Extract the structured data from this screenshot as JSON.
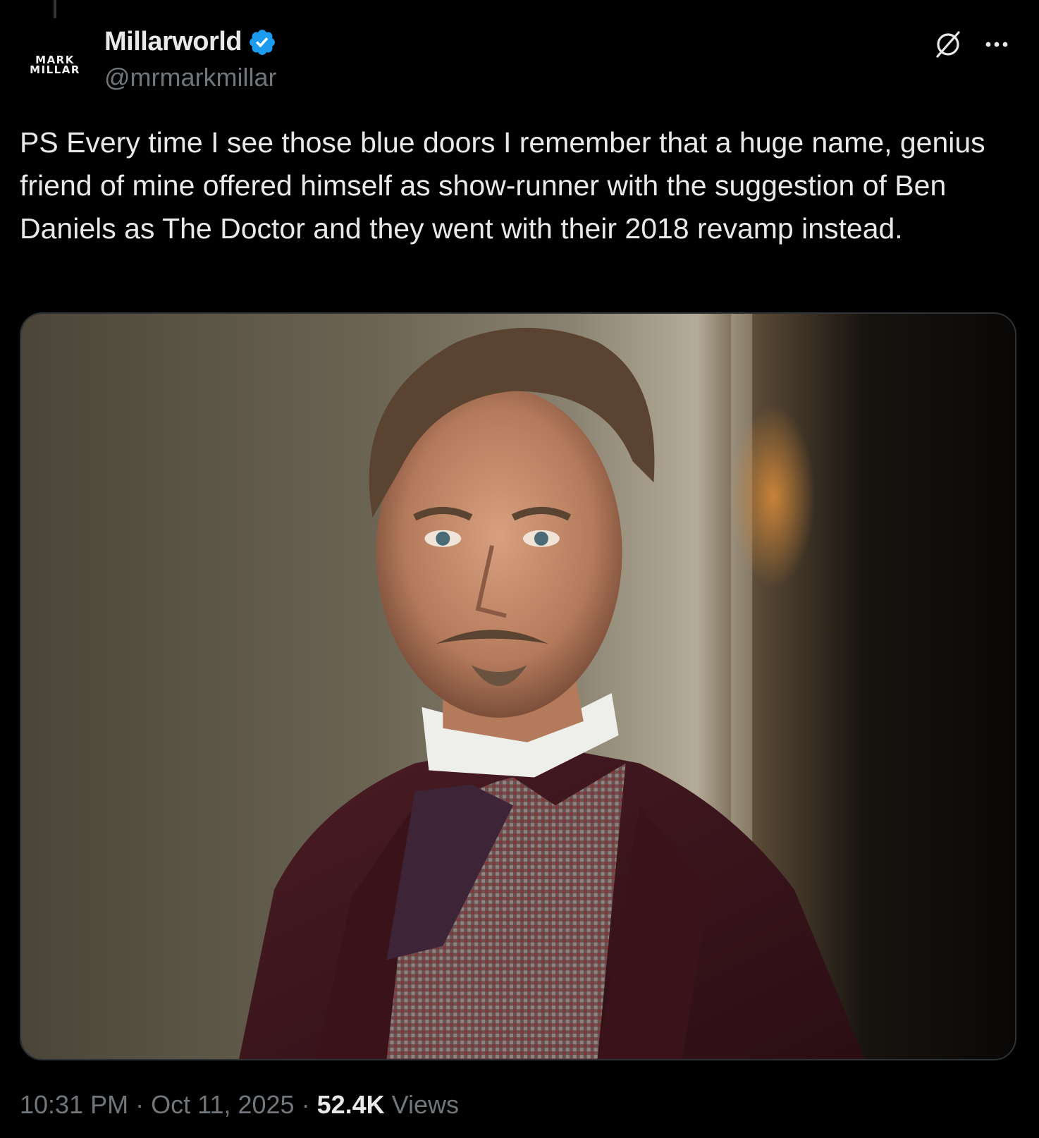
{
  "author": {
    "avatar_line1": "MARK",
    "avatar_line2": "MILLAR",
    "display_name": "Millarworld",
    "handle": "@mrmarkmillar",
    "verified": true,
    "verified_color": "#1d9bf0"
  },
  "icons": {
    "grok": "grok-icon",
    "more": "more-options-icon",
    "verified": "verified-badge-icon"
  },
  "tweet": {
    "text": "PS Every time I see those blue doors I remember that a huge name, genius friend of mine offered himself as show-runner with the suggestion of Ben Daniels as The Doctor and they went with their 2018 revamp instead."
  },
  "meta": {
    "time": "10:31 PM",
    "separator": " · ",
    "date": "Oct 11, 2025",
    "views_count": "52.4K",
    "views_label": "Views"
  },
  "colors": {
    "background": "#000000",
    "text_primary": "#e7e9ea",
    "text_secondary": "#71767b",
    "border": "#2f3336"
  }
}
